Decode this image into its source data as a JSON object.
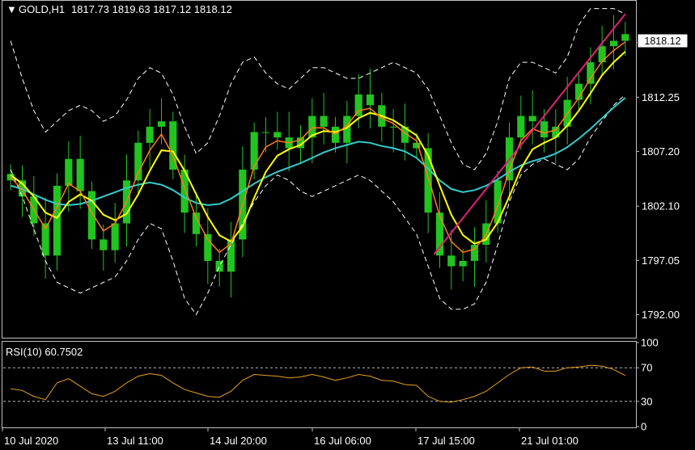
{
  "header": {
    "symbol_label": "GOLD,H1",
    "ohlc_label": "1817.73 1819.63 1817.12 1818.12"
  },
  "rsi_panel": {
    "label": "RSI(10) 60.7502"
  },
  "price_badge": "1818.12",
  "colors": {
    "background": "#000000",
    "frame": "#c0c0c0",
    "axis_text": "#ffffff",
    "candles": "#22c41f",
    "ma_fast": "#ff7a1a",
    "ma_mid": "#ffff00",
    "ma_slow": "#33cccc",
    "bands": "#ffffff",
    "trendline": "#e0207a",
    "rsi_line": "#e6a020"
  },
  "chart_data": [
    {
      "type": "line",
      "title": "GOLD,H1",
      "x": [
        "10 Jul 2020",
        "13 Jul 11:00",
        "14 Jul 20:00",
        "16 Jul 06:00",
        "17 Jul 15:00",
        "21 Jul 01:00"
      ],
      "ylim": [
        1790.0,
        1821.0
      ],
      "yticks": [
        "1817.35",
        "1812.25",
        "1807.20",
        "1802.10",
        "1797.05",
        "1792.00"
      ],
      "ytick_values": [
        1817.35,
        1812.25,
        1807.2,
        1802.1,
        1797.05,
        1792.0
      ],
      "last_price": 1818.12,
      "series": [
        {
          "role": "close",
          "values": [
            1804.5,
            1803.0,
            1800.5,
            1797.5,
            1804.0,
            1806.5,
            1803.5,
            1799.0,
            1798.0,
            1800.5,
            1804.5,
            1808.0,
            1809.5,
            1810.0,
            1805.5,
            1801.5,
            1799.5,
            1797.0,
            1796.0,
            1799.0,
            1805.5,
            1809.0,
            1809.0,
            1808.5,
            1807.5,
            1808.5,
            1810.5,
            1809.5,
            1808.0,
            1810.5,
            1812.5,
            1811.5,
            1809.5,
            1809.5,
            1808.0,
            1807.5,
            1801.5,
            1797.5,
            1796.5,
            1797.0,
            1798.5,
            1800.5,
            1804.5,
            1808.5,
            1810.5,
            1810.0,
            1808.5,
            1809.5,
            1812.0,
            1813.5,
            1815.5,
            1817.0,
            1817.5,
            1818.12
          ]
        },
        {
          "role": "ma_fast",
          "values": [
            1804.8,
            1803.6,
            1801.8,
            1800.0,
            1802.0,
            1804.2,
            1803.5,
            1801.5,
            1799.8,
            1800.5,
            1802.5,
            1805.2,
            1807.3,
            1808.8,
            1806.8,
            1803.8,
            1801.0,
            1799.0,
            1797.8,
            1798.6,
            1802.2,
            1805.8,
            1807.6,
            1808.2,
            1808.0,
            1808.3,
            1809.4,
            1809.4,
            1808.8,
            1809.6,
            1811.0,
            1811.2,
            1810.3,
            1809.8,
            1808.9,
            1808.2,
            1804.8,
            1801.2,
            1798.8,
            1797.8,
            1798.1,
            1799.4,
            1802.1,
            1805.4,
            1808.2,
            1809.3,
            1808.9,
            1809.2,
            1810.7,
            1812.2,
            1814.0,
            1815.6,
            1816.6,
            1817.4
          ]
        },
        {
          "role": "ma_mid",
          "values": [
            1805.0,
            1804.2,
            1803.0,
            1801.5,
            1801.0,
            1802.5,
            1803.2,
            1802.6,
            1801.3,
            1800.8,
            1801.4,
            1803.2,
            1805.4,
            1807.3,
            1807.2,
            1805.4,
            1803.2,
            1801.1,
            1799.4,
            1798.8,
            1800.2,
            1802.9,
            1805.3,
            1806.8,
            1807.4,
            1807.8,
            1808.7,
            1809.1,
            1809.0,
            1809.4,
            1810.3,
            1810.8,
            1810.5,
            1810.1,
            1809.4,
            1808.7,
            1806.8,
            1804.0,
            1801.3,
            1799.4,
            1798.6,
            1799.0,
            1800.6,
            1803.0,
            1805.6,
            1807.4,
            1808.0,
            1808.5,
            1809.6,
            1811.0,
            1812.6,
            1814.3,
            1815.5,
            1816.5
          ]
        },
        {
          "role": "ma_slow",
          "values": [
            1804.0,
            1803.7,
            1803.2,
            1802.7,
            1802.3,
            1802.2,
            1802.3,
            1802.6,
            1803.0,
            1803.4,
            1803.8,
            1804.1,
            1804.3,
            1804.1,
            1803.6,
            1802.9,
            1802.4,
            1802.2,
            1802.3,
            1802.8,
            1803.5,
            1804.2,
            1804.8,
            1805.3,
            1805.7,
            1806.1,
            1806.6,
            1807.1,
            1807.5,
            1807.8,
            1808.1,
            1808.0,
            1807.7,
            1807.5,
            1807.2,
            1806.6,
            1805.6,
            1804.5,
            1803.7,
            1803.4,
            1803.6,
            1804.0,
            1804.6,
            1805.3,
            1805.9,
            1806.3,
            1806.6,
            1807.0,
            1807.6,
            1808.4,
            1809.3,
            1810.3,
            1811.3,
            1812.2
          ]
        },
        {
          "role": "band_upper",
          "values": [
            1817.5,
            1814.0,
            1811.0,
            1809.0,
            1810.0,
            1811.0,
            1811.5,
            1811.0,
            1810.0,
            1810.5,
            1812.0,
            1814.0,
            1815.0,
            1814.5,
            1812.5,
            1809.5,
            1807.0,
            1808.0,
            1810.5,
            1813.5,
            1815.5,
            1816.0,
            1814.5,
            1813.5,
            1813.0,
            1814.0,
            1815.0,
            1815.0,
            1814.5,
            1814.0,
            1814.0,
            1814.5,
            1815.0,
            1815.5,
            1815.0,
            1814.5,
            1813.0,
            1810.5,
            1808.0,
            1806.0,
            1805.5,
            1807.0,
            1810.0,
            1814.0,
            1815.5,
            1815.5,
            1815.0,
            1814.5,
            1816.0,
            1819.0,
            1820.5,
            1820.5,
            1820.5,
            1820.0
          ]
        },
        {
          "role": "band_lower",
          "values": [
            1805.5,
            1803.0,
            1800.0,
            1797.0,
            1795.0,
            1794.5,
            1794.0,
            1794.5,
            1795.0,
            1795.5,
            1797.0,
            1799.0,
            1800.5,
            1800.0,
            1797.0,
            1793.5,
            1792.0,
            1794.0,
            1796.5,
            1798.5,
            1800.5,
            1802.5,
            1804.0,
            1805.0,
            1804.5,
            1803.5,
            1803.0,
            1803.5,
            1804.0,
            1804.5,
            1805.0,
            1804.5,
            1803.5,
            1802.5,
            1801.0,
            1799.5,
            1796.5,
            1793.5,
            1792.5,
            1792.5,
            1793.0,
            1795.0,
            1798.5,
            1802.5,
            1805.0,
            1806.0,
            1806.5,
            1806.0,
            1805.5,
            1806.5,
            1808.5,
            1810.0,
            1811.5,
            1812.5
          ]
        }
      ],
      "trendline": {
        "from": {
          "bar": 36.5,
          "price": 1797.6
        },
        "to": {
          "bar": 53.0,
          "price": 1820.0
        }
      }
    },
    {
      "type": "line",
      "title": "RSI(10) 60.7502",
      "x": [
        "10 Jul 2020",
        "13 Jul 11:00",
        "14 Jul 20:00",
        "16 Jul 06:00",
        "17 Jul 15:00",
        "21 Jul 01:00"
      ],
      "ylim": [
        0,
        100
      ],
      "yticks": [
        "100",
        "70",
        "30",
        "0"
      ],
      "ytick_values": [
        100,
        70,
        30,
        0
      ],
      "levels": [
        70,
        30
      ],
      "series": [
        {
          "name": "RSI(10)",
          "values": [
            45,
            43,
            36,
            32,
            52,
            57,
            48,
            39,
            36,
            42,
            52,
            60,
            63,
            61,
            52,
            44,
            40,
            36,
            35,
            42,
            55,
            62,
            61,
            60,
            58,
            59,
            62,
            59,
            55,
            58,
            62,
            60,
            55,
            54,
            50,
            49,
            36,
            30,
            29,
            32,
            36,
            42,
            52,
            62,
            70,
            71,
            66,
            66,
            70,
            71,
            73,
            72,
            68,
            60.75
          ]
        }
      ]
    }
  ],
  "x_axis": {
    "labels": [
      "10 Jul 2020",
      "13 Jul 11:00",
      "14 Jul 20:00",
      "16 Jul 06:00",
      "17 Jul 15:00",
      "21 Jul 01:00"
    ]
  }
}
